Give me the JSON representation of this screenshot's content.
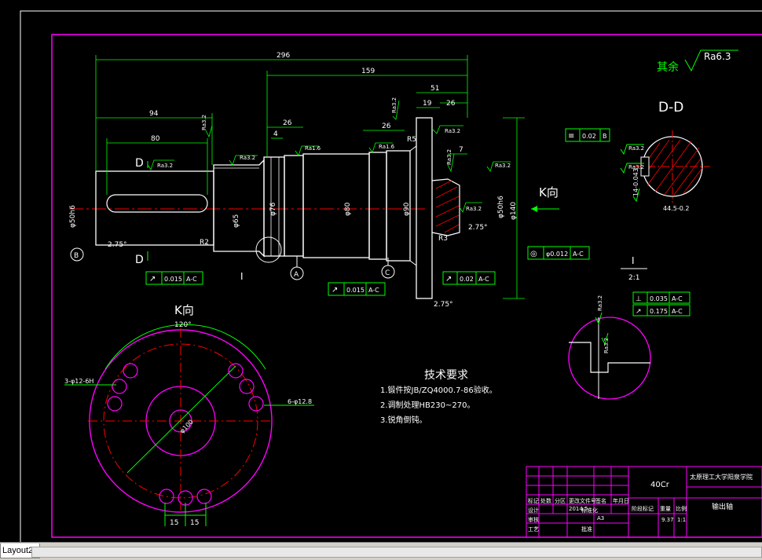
{
  "colors": {
    "background": "#000000",
    "border": "#ff00ff",
    "dimension": "#00ff00",
    "outline": "#ffffff",
    "centerline": "#ff0000",
    "hatch": "#ff0000",
    "text_white": "#ffffff"
  },
  "roughness_general": {
    "prefix": "其余",
    "value": "Ra6.3"
  },
  "dims": {
    "d296": "296",
    "d159": "159",
    "d94": "94",
    "d80": "80",
    "d51": "51",
    "d19": "19",
    "d26a": "26",
    "d26b": "26",
    "d26c": "26",
    "d4": "4",
    "d7": "7",
    "phi50": "φ50h6",
    "phi65": "φ65",
    "phi76": "φ76",
    "phi80": "φ80",
    "phi90": "φ90",
    "phi140": "φ140",
    "phi50b": "φ50h6",
    "chamfer_a": "2.75°",
    "chamfer_b": "2.75°",
    "chamfer_c": "2.75°",
    "r2": "R2",
    "r3": "R3",
    "r5": "R5"
  },
  "roughness": {
    "ra32_a": "Ra3.2",
    "ra32_b": "Ra3.2",
    "ra32_c": "Ra3.2",
    "ra32_d": "Ra3.2",
    "ra32_e": "Ra3.2",
    "ra32_f": "Ra3.2",
    "ra32_g": "Ra3.2",
    "ra16_a": "Ra1.6",
    "ra16_b": "Ra1.6",
    "ra32_h": "Ra3.2",
    "ra32_i": "Ra3.2",
    "ra32_j": "Ra3.2",
    "ra32_k": "Ra3.2",
    "ra32_l": "Ra3.2"
  },
  "section_labels": {
    "d_top": "D",
    "d_bottom": "D",
    "k_view": "K向",
    "k_view_title": "K向",
    "dd_title": "D-D",
    "detail_i": "I",
    "detail_scale": "2:1",
    "detail_i_marker": "I"
  },
  "datums": {
    "a": "A",
    "b": "B",
    "c": "C"
  },
  "tolerances": {
    "runout_b": {
      "symbol": "↗",
      "value": "0.015",
      "datum": "A-C"
    },
    "runout_c": {
      "symbol": "↗",
      "value": "0.015",
      "datum": "A-C"
    },
    "runout_flange": {
      "symbol": "↗",
      "value": "0.02",
      "datum": "A-C"
    },
    "concentric": {
      "symbol": "◎",
      "value": "φ0.012",
      "datum": "A-C"
    },
    "symmetry": {
      "symbol": "≡",
      "value": "0.02",
      "datum": "B"
    },
    "detail_1": {
      "symbol": "⊥",
      "value": "0.035",
      "datum": "A-C"
    },
    "detail_2": {
      "symbol": "↗",
      "value": "0.175",
      "datum": "A-C"
    }
  },
  "dd_dims": {
    "width": "44.5-0.2",
    "key": "14-0.043"
  },
  "k_view_dims": {
    "angle": "120°",
    "holes_a": "3-φ12-6H",
    "holes_b": "6-φ12.8",
    "spacing_a": "15",
    "spacing_b": "15",
    "pcd": "φ100"
  },
  "tech_requirements": {
    "title": "技术要求",
    "item1": "1.锻件按JB/ZQ4000.7-86验收。",
    "item2": "2.调制处理HB230~270。",
    "item3": "3.锐角倒钝。"
  },
  "title_block": {
    "material": "40Cr",
    "school": "太原理工大学阳泉学院",
    "part_name": "输出轴",
    "scale": "1:1",
    "weight": "9.37",
    "sheet": "A3",
    "date": "2014.5",
    "cells": [
      "标记",
      "处数",
      "分区",
      "更改文件号",
      "签名",
      "年月日",
      "设计",
      "标准化",
      "审核",
      "工艺",
      "阶段标记",
      "重量",
      "比例",
      "批准"
    ]
  },
  "layout_tab": "Layout2"
}
